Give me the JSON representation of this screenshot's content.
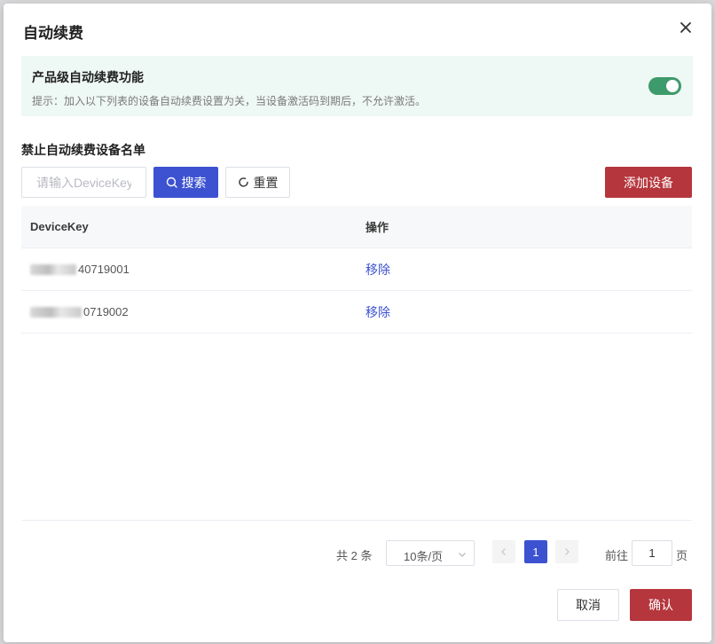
{
  "dialog": {
    "title": "自动续费",
    "close_icon": "close-icon"
  },
  "notice": {
    "title": "产品级自动续费功能",
    "hint": "提示：加入以下列表的设备自动续费设置为关，当设备激活码到期后，不允许激活。",
    "toggle_on": true,
    "toggle_color": "#3d9a6a"
  },
  "section": {
    "title": "禁止自动续费设备名单"
  },
  "toolbar": {
    "search_placeholder": "请输入DeviceKey",
    "search_value": "",
    "search_label": "搜索",
    "reset_label": "重置",
    "add_label": "添加设备"
  },
  "table": {
    "columns": [
      "DeviceKey",
      "操作"
    ],
    "rows": [
      {
        "device_key_visible": "40719001",
        "action": "移除"
      },
      {
        "device_key_visible": "0719002",
        "action": "移除"
      }
    ]
  },
  "pagination": {
    "total_text": "共 2 条",
    "page_size": "10条/页",
    "current_page": "1",
    "goto_label": "前往",
    "goto_value": "1",
    "goto_suffix": "页"
  },
  "footer": {
    "cancel_label": "取消",
    "confirm_label": "确认"
  },
  "colors": {
    "primary": "#3c52d1",
    "danger": "#b5363c",
    "notice_bg": "#eef8f4"
  }
}
